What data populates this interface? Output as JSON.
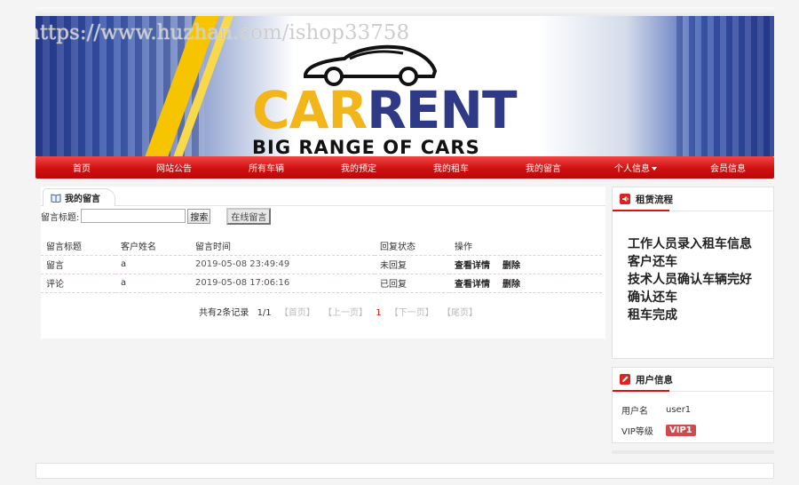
{
  "banner": {
    "watermark": "https://www.huzhan.com/ishop33758",
    "logo_car": "CAR",
    "logo_rent": "RENT",
    "tagline": "BIG RANGE OF CARS"
  },
  "nav": {
    "items": [
      {
        "label": "首页"
      },
      {
        "label": "网站公告"
      },
      {
        "label": "所有车辆"
      },
      {
        "label": "我的预定"
      },
      {
        "label": "我的租车"
      },
      {
        "label": "我的留言"
      },
      {
        "label": "个人信息",
        "has_dropdown": true
      },
      {
        "label": "会员信息"
      }
    ]
  },
  "main": {
    "tab_label": "我的留言",
    "search_label": "留言标题:",
    "search_value": "",
    "search_button": "搜索",
    "online_button": "在线留言",
    "table": {
      "headers": [
        "留言标题",
        "客户姓名",
        "留言时间",
        "回复状态",
        "操作"
      ],
      "rows": [
        {
          "title": "留言",
          "customer": "a",
          "time": "2019-05-08 23:49:49",
          "status": "未回复",
          "view": "查看详情",
          "delete": "删除"
        },
        {
          "title": "评论",
          "customer": "a",
          "time": "2019-05-08 17:06:16",
          "status": "已回复",
          "view": "查看详情",
          "delete": "删除"
        }
      ]
    },
    "pager": {
      "summary": "共有2条记录",
      "page_of": "1/1",
      "first": "【首页】",
      "prev": "【上一页】",
      "current": "1",
      "next": "【下一页】",
      "last": "【尾页】"
    }
  },
  "sidebar": {
    "process": {
      "title": "租赁流程",
      "steps": [
        "工作人员录入租车信息",
        "客户还车",
        "技术人员确认车辆完好",
        "确认还车",
        "租车完成"
      ]
    },
    "user": {
      "title": "用户信息",
      "username_label": "用户名",
      "username": "user1",
      "level_label": "VIP等级",
      "level": "VIP1"
    }
  },
  "colors": {
    "nav_red": "#d11010",
    "accent_red": "#dd1111",
    "logo_yellow": "#f2b61a",
    "logo_navy": "#2e3a86",
    "vip_badge": "#cf4b4b"
  }
}
